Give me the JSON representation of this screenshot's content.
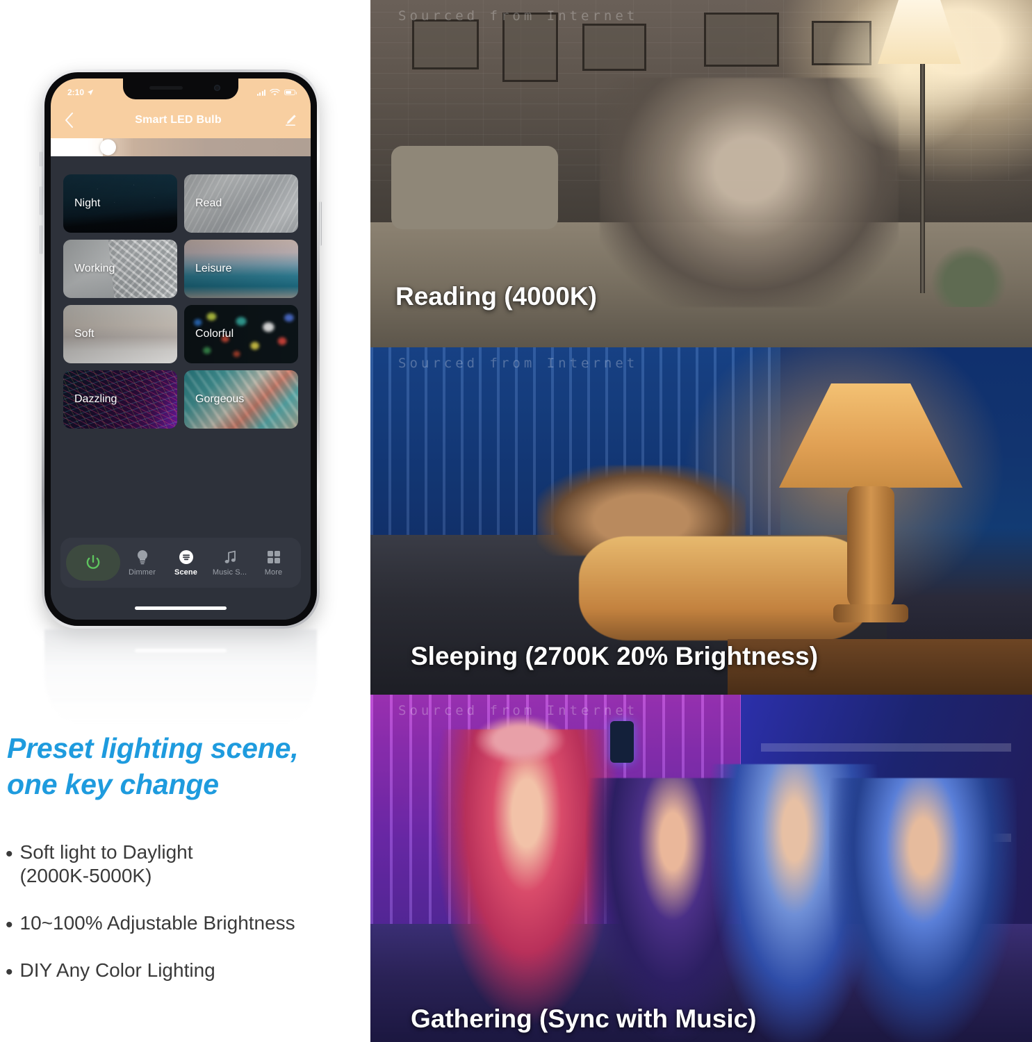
{
  "phone": {
    "status_bar": {
      "time": "2:10",
      "location_icon": "location-arrow-icon",
      "signal_icon": "cellular-signal-icon",
      "wifi_icon": "wifi-icon",
      "battery_icon": "battery-icon"
    },
    "nav": {
      "back_icon": "chevron-left-icon",
      "title": "Smart LED Bulb",
      "edit_icon": "pencil-edit-icon"
    },
    "brightness": {
      "value_percent": 20
    },
    "edit_fab_icon": "pencil-icon",
    "scenes": [
      {
        "label": "Night",
        "art": "bg-night"
      },
      {
        "label": "Read",
        "art": "bg-read"
      },
      {
        "label": "Working",
        "art": "bg-working"
      },
      {
        "label": "Leisure",
        "art": "bg-leisure"
      },
      {
        "label": "Soft",
        "art": "bg-soft"
      },
      {
        "label": "Colorful",
        "art": "bg-colorful"
      },
      {
        "label": "Dazzling",
        "art": "bg-dazzling"
      },
      {
        "label": "Gorgeous",
        "art": "bg-gorgeous"
      }
    ],
    "tabbar": {
      "power_icon": "power-button-icon",
      "power_color": "#5ec45e",
      "items": [
        {
          "label": "Dimmer",
          "icon": "bulb-icon",
          "active": false
        },
        {
          "label": "Scene",
          "icon": "scene-icon",
          "active": true
        },
        {
          "label": "Music S...",
          "icon": "music-note-icon",
          "active": false
        },
        {
          "label": "More",
          "icon": "grid-icon",
          "active": false
        }
      ]
    }
  },
  "marketing": {
    "headline_line1": "Preset lighting scene,",
    "headline_line2": "one key change",
    "headline_color": "#1e9bde",
    "bullets": [
      "Soft light to Daylight\n(2000K-5000K)",
      "10~100% Adjustable Brightness",
      "DIY Any Color Lighting"
    ]
  },
  "photos": [
    {
      "watermark": "Sourced from Internet",
      "caption": "Reading (4000K)"
    },
    {
      "watermark": "Sourced from Internet",
      "caption": "Sleeping (2700K 20% Brightness)"
    },
    {
      "watermark": "Sourced from Internet",
      "caption": "Gathering (Sync with Music)"
    }
  ]
}
